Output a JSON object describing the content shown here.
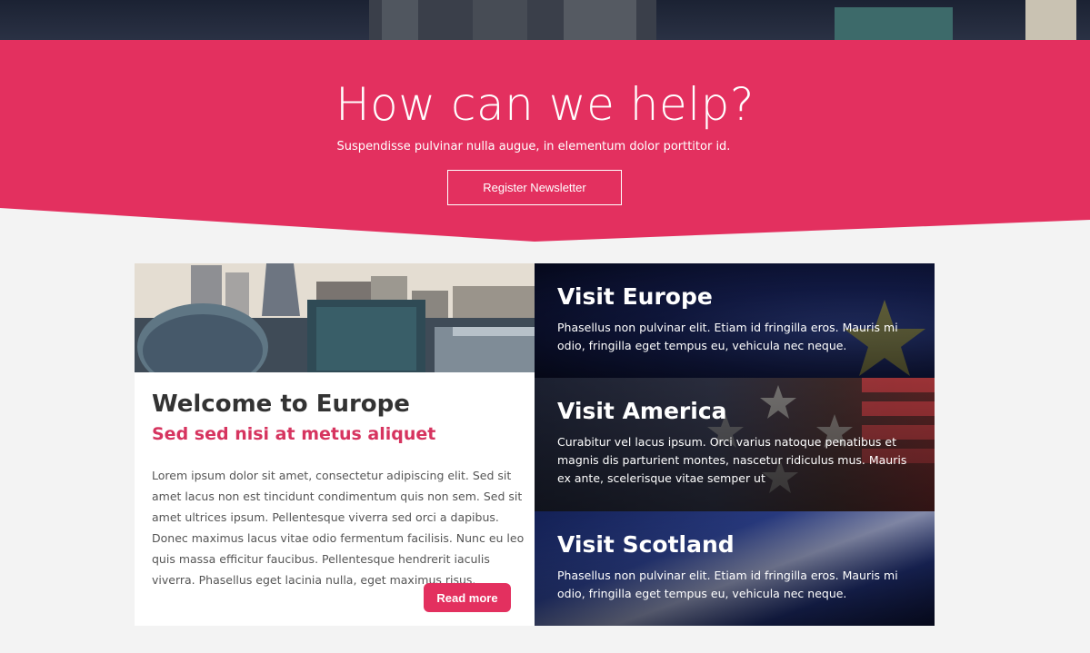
{
  "hero": {
    "title": "How can we help?",
    "subtitle": "Suspendisse pulvinar nulla augue, in elementum dolor porttitor id.",
    "button_label": "Register Newsletter",
    "accent_color": "#e3305f"
  },
  "welcome": {
    "title": "Welcome to Europe",
    "subtitle": "Sed sed nisi at metus aliquet",
    "body": "Lorem ipsum dolor sit amet, consectetur adipiscing elit. Sed sit amet lacus non est tincidunt condimentum quis non sem. Sed sit amet ultrices ipsum. Pellentesque viverra sed orci a dapibus. Donec maximus lacus vitae odio fermentum facilisis. Nunc eu leo quis massa efficitur faucibus. Pellentesque hendrerit iaculis viverra. Phasellus eget lacinia nulla, eget maximus risus.",
    "read_more_label": "Read more"
  },
  "destinations": [
    {
      "title": "Visit Europe",
      "text": "Phasellus non pulvinar elit. Etiam id fringilla eros. Mauris mi odio, fringilla eget tempus eu, vehicula nec neque."
    },
    {
      "title": "Visit America",
      "text": "Curabitur vel lacus ipsum. Orci varius natoque penatibus et magnis dis parturient montes, nascetur ridiculus mus. Mauris ex ante, scelerisque vitae semper ut"
    },
    {
      "title": "Visit Scotland",
      "text": "Phasellus non pulvinar elit. Etiam id fringilla eros. Mauris mi odio, fringilla eget tempus eu, vehicula nec neque."
    }
  ]
}
